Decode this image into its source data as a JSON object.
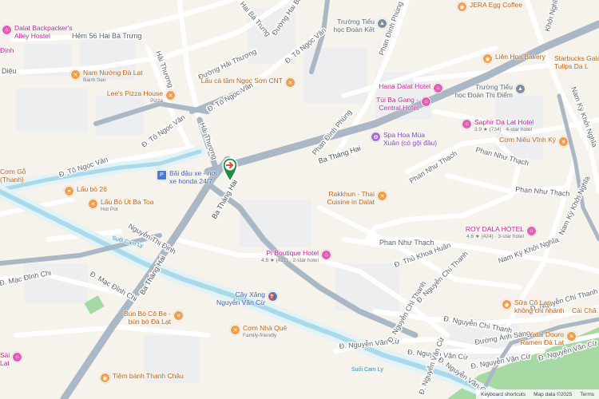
{
  "map": {
    "colors": {
      "background": "#f6f3ec",
      "block": "#eceef0",
      "road": "#ffffff",
      "major_road": "#aab7c4",
      "water": "#aadaea",
      "water_bank": "#e2f3f7",
      "park": "#a6d9a4",
      "marker": "#1e8e3e"
    },
    "roads": [
      {
        "label": "Đường Hải Thượng",
        "kind": "minor"
      },
      {
        "label": "Đường Hai Bà Trưng",
        "kind": "minor"
      },
      {
        "label": "Hai Bà Trưng",
        "kind": "minor"
      },
      {
        "label": "Đ. Tô Ngọc Vân",
        "kind": "minor"
      },
      {
        "label": "Đ. Tô Ngọc Vân",
        "kind": "minor"
      },
      {
        "label": "Đ. Tô Ngọc Vân",
        "kind": "minor"
      },
      {
        "label": "Đ. Tô Ngọc Vân",
        "kind": "minor"
      },
      {
        "label": "Hải Thượng",
        "kind": "minor"
      },
      {
        "label": "Hải Thượng",
        "kind": "minor"
      },
      {
        "label": "Phan Đình Phùng",
        "kind": "minor"
      },
      {
        "label": "Phan Đình Phùng",
        "kind": "minor"
      },
      {
        "label": "Ba Tháng Hai",
        "kind": "major"
      },
      {
        "label": "Ba Tháng Hai",
        "kind": "major"
      },
      {
        "label": "Ba Tháng Hai",
        "kind": "major"
      },
      {
        "label": "Phan Như Thạch",
        "kind": "minor"
      },
      {
        "label": "Phan Như Thạch",
        "kind": "minor"
      },
      {
        "label": "Phan Như Thạch",
        "kind": "minor"
      },
      {
        "label": "Phan Như Thạch",
        "kind": "minor"
      },
      {
        "label": "Nam Kỳ Khởi Nghĩa",
        "kind": "minor"
      },
      {
        "label": "Nam Kỳ Khởi Nghĩa",
        "kind": "minor"
      },
      {
        "label": "Nam Kỳ Khởi Nghĩa",
        "kind": "minor"
      },
      {
        "label": "Đ. Mạc Đĩnh Chi",
        "kind": "minor"
      },
      {
        "label": "Đ. Mạc Đĩnh Chi",
        "kind": "minor"
      },
      {
        "label": "Đ. Nguyễn Văn Cừ",
        "kind": "minor"
      },
      {
        "label": "Đ. Nguyễn Văn Cừ",
        "kind": "minor"
      },
      {
        "label": "Đ. Nguyễn Văn Cừ",
        "kind": "minor"
      },
      {
        "label": "Đ. Nguyễn Văn Cừ",
        "kind": "minor"
      },
      {
        "label": "Đ. Nguyễn Văn Cừ",
        "kind": "minor"
      },
      {
        "label": "Đ. Nguyễn Văn Cừ",
        "kind": "minor"
      },
      {
        "label": "Đ. Nguyễn Chí Thanh",
        "kind": "minor"
      },
      {
        "label": "Đ. Nguyễn Chí Thanh",
        "kind": "minor"
      },
      {
        "label": "Đ. Nguyễn Chí Thanh",
        "kind": "minor"
      },
      {
        "label": "Đ. Nguyễn Chí Thanh",
        "kind": "minor"
      },
      {
        "label": "Nguyễn Thị Định",
        "kind": "minor"
      },
      {
        "label": "Đ. Thủ Khoa Huân",
        "kind": "minor"
      },
      {
        "label": "Đường Ánh Sáng",
        "kind": "minor"
      },
      {
        "label": "Khởi Nghĩa",
        "kind": "minor"
      },
      {
        "label": "Hẻm 56 Hai Bà Trưng",
        "kind": "minor"
      },
      {
        "label": "Diệu",
        "kind": "minor"
      }
    ],
    "water_labels": [
      "Suối Cam Ly",
      "Suối Cam Ly"
    ],
    "pois": [
      {
        "name": "Dalat Backpacker's",
        "sub": "Alley Hostel",
        "category": "hotel",
        "icon": "bed-icon"
      },
      {
        "name": "Nam Nướng Đà Lạt",
        "sub": "Bánh Sẹo",
        "category": "food",
        "icon": "restaurant-icon"
      },
      {
        "name": "Lee's Pizza House",
        "sub": "Pizza",
        "category": "food",
        "icon": "restaurant-icon"
      },
      {
        "name": "Lẩu cá tầm Ngọc Sơn CNT",
        "sub": "",
        "category": "food",
        "icon": "restaurant-icon"
      },
      {
        "name": "Trường Tiểu",
        "sub": "học Đoàn Kết",
        "category": "school",
        "icon": "school-icon"
      },
      {
        "name": "Hana Dalat Hotel",
        "sub": "",
        "category": "hotel",
        "icon": "bed-icon"
      },
      {
        "name": "Túi Ba Gang -",
        "sub": "Central Hotel",
        "category": "hotel",
        "icon": "bed-icon"
      },
      {
        "name": "Trường Tiểu",
        "sub": "học Đoàn Thị Điểm",
        "category": "school",
        "icon": "school-icon"
      },
      {
        "name": "Spa Hoa Mùa",
        "sub": "Xuân (có gội đầu)",
        "category": "spa",
        "icon": "spa-icon"
      },
      {
        "name": "Saphir Da Lat Hotel",
        "sub": "3.9 ★ (734) · 4-star hotel",
        "category": "hotel",
        "icon": "bed-icon"
      },
      {
        "name": "Cơm Niêu Vĩnh Ký",
        "sub": "",
        "category": "food",
        "icon": "restaurant-icon"
      },
      {
        "name": "Liên Hoa Bakery",
        "sub": "",
        "category": "food",
        "icon": "bakery-icon"
      },
      {
        "name": "JERA Egg Coffee",
        "sub": "",
        "category": "food",
        "icon": "cafe-icon"
      },
      {
        "name": "Starbucks Gala",
        "sub": "Tulips Da L",
        "category": "food",
        "icon": "cafe-icon"
      },
      {
        "name": "Bãi đậu xe - nơi",
        "sub": "xe honda 24/7",
        "category": "parking",
        "icon": "parking-icon"
      },
      {
        "name": "Lẩu bò 26",
        "sub": "",
        "category": "food",
        "icon": "restaurant-icon"
      },
      {
        "name": "Lẩu Bò Út Ba Toa",
        "sub": "Hot Pot",
        "category": "food",
        "icon": "restaurant-icon"
      },
      {
        "name": "Rakkhun - Thai",
        "sub": "Cuisine in Dalat",
        "category": "food",
        "icon": "restaurant-icon"
      },
      {
        "name": "ROY DALA HOTEL",
        "sub": "4.6 ★ (424) · 3-star hotel",
        "category": "hotel",
        "icon": "bed-icon"
      },
      {
        "name": "Pi Boutique Hotel",
        "sub": "4.5 ★ (421) · 2-star hotel",
        "category": "hotel",
        "icon": "bed-icon"
      },
      {
        "name": "Cây Xăng",
        "sub": "Nguyễn Văn Cừ",
        "category": "fuel",
        "icon": "gas-station-icon"
      },
      {
        "name": "Bún Bò Cô Be -",
        "sub": "bún bò Đà Lạt",
        "category": "food",
        "icon": "restaurant-icon"
      },
      {
        "name": "Cơm Nhà Quê",
        "sub": "Family-friendly",
        "category": "food",
        "icon": "restaurant-icon"
      },
      {
        "name": "Tiệm bánh Thanh Châu",
        "sub": "",
        "category": "food",
        "icon": "bakery-icon"
      },
      {
        "name": "Sữa Cô Lan",
        "sub": "không chi nhánh",
        "category": "food",
        "icon": "cafe-icon"
      },
      {
        "name": "Yatai Douro",
        "sub": "Ramen Đà Lạt",
        "category": "food",
        "icon": "restaurant-icon"
      },
      {
        "name": "Cơm Gỗ",
        "sub": "(Thanh)",
        "category": "food",
        "icon": "restaurant-icon"
      },
      {
        "name": "Cái Châ",
        "sub": "",
        "category": "food",
        "icon": "restaurant-icon"
      },
      {
        "name": "Sài",
        "sub": "Lạt",
        "category": "hotel",
        "icon": "bed-icon"
      },
      {
        "name": "Định",
        "sub": "",
        "category": "hotel",
        "icon": "bed-icon"
      }
    ],
    "marker": {
      "icon": "arrow-right-icon"
    },
    "attribution": {
      "shortcuts": "Keyboard shortcuts",
      "copyright": "Map data ©2025",
      "terms": "Terms"
    }
  }
}
